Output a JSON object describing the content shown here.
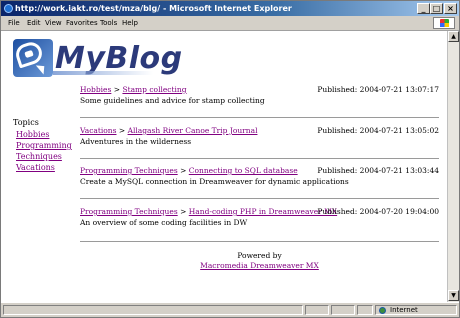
{
  "window": {
    "title": "http://work.iakt.ro/test/mza/blg/ - Microsoft Internet Explorer"
  },
  "menu": [
    "File",
    "Edit",
    "View",
    "Favorites",
    "Tools",
    "Help"
  ],
  "header": {
    "brand": "MyBlog"
  },
  "sidebar": {
    "heading": "Topics",
    "items": [
      "Hobbies",
      "Programming Techniques",
      "Vacations"
    ]
  },
  "posts": [
    {
      "category": "Hobbies",
      "separator": ">",
      "title": "Stamp collecting",
      "published": "Published: 2004-07-21 13:07:17",
      "description": "Some guidelines and advice for stamp collecting"
    },
    {
      "category": "Vacations",
      "separator": ">",
      "title": "Allagash River Canoe Trip Journal",
      "published": "Published: 2004-07-21 13:05:02",
      "description": "Adventures in the wilderness"
    },
    {
      "category": "Programming Techniques",
      "separator": ">",
      "title": "Connecting to SQL database",
      "published": "Published: 2004-07-21 13:03:44",
      "description": "Create a MySQL connection in Dreamweaver for dynamic applications"
    },
    {
      "category": "Programming Techniques",
      "separator": ">",
      "title": "Hand-coding PHP in Dreamweaver MX",
      "published": "Published: 2004-07-20 19:04:00",
      "description": "An overview of some coding facilities in DW"
    }
  ],
  "footer": {
    "powered_by": "Powered by",
    "link": "Macromedia Dreamweaver MX"
  },
  "status": {
    "zone": "Internet"
  },
  "colors": {
    "link_visited": "#800080",
    "titlebar": "#0a246a",
    "brand": "#2c3a7a"
  }
}
